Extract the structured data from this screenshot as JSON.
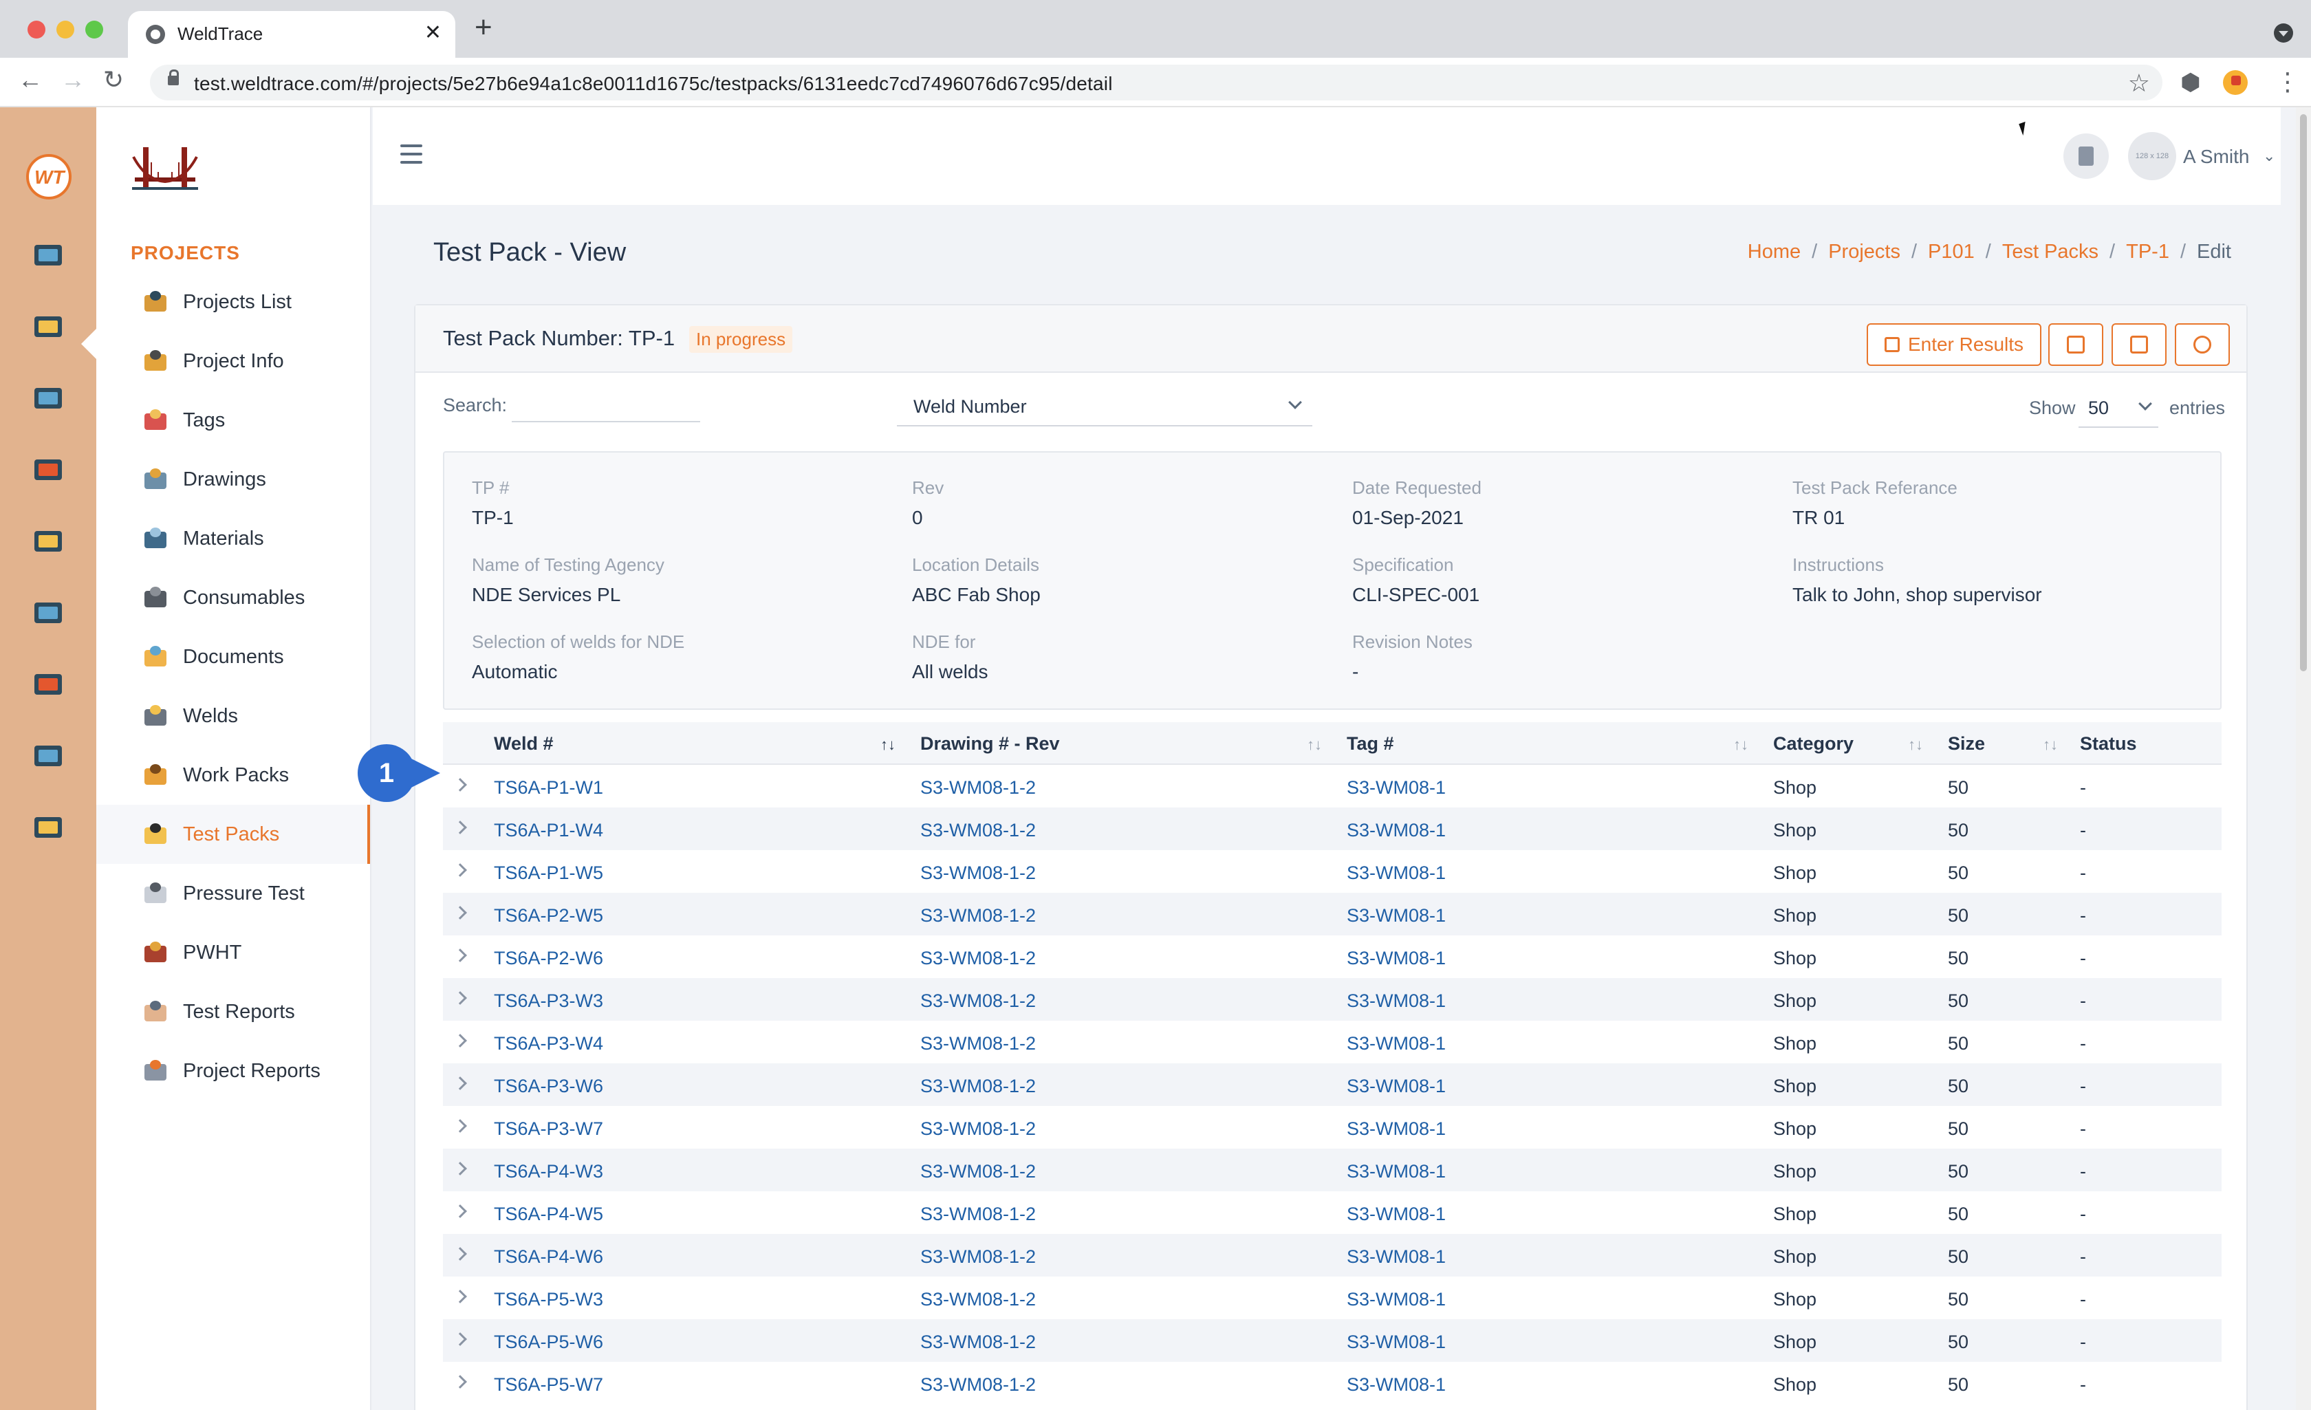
{
  "browser": {
    "tab_title": "WeldTrace",
    "tab_close": "✕",
    "new_tab": "+",
    "url": "test.weldtrace.com/#/projects/5e27b6e94a1c8e0011d1675c/testpacks/6131eedc7cd7496076d67c95/detail",
    "back": "←",
    "forward": "→",
    "reload": "↻",
    "star": "☆",
    "extensions": "⬢",
    "menu": "⋮"
  },
  "rail": {
    "logo_text": "WT",
    "icons": [
      "monitor-icon",
      "folder-gear-icon",
      "clipboard-gear-icon",
      "welder-icon",
      "org-chart-icon",
      "blueprint-icon",
      "team-icon",
      "report-icon",
      "badge-icon"
    ]
  },
  "sidebar": {
    "section_title": "PROJECTS",
    "items": [
      {
        "label": "Projects List",
        "icon": "camera-icon"
      },
      {
        "label": "Project Info",
        "icon": "gears-icon"
      },
      {
        "label": "Tags",
        "icon": "tag-icon"
      },
      {
        "label": "Drawings",
        "icon": "drawing-gear-icon"
      },
      {
        "label": "Materials",
        "icon": "pipes-icon"
      },
      {
        "label": "Consumables",
        "icon": "rods-icon"
      },
      {
        "label": "Documents",
        "icon": "folder-icon"
      },
      {
        "label": "Welds",
        "icon": "weld-spark-icon"
      },
      {
        "label": "Work Packs",
        "icon": "box-icon"
      },
      {
        "label": "Test Packs",
        "icon": "radiation-icon"
      },
      {
        "label": "Pressure Test",
        "icon": "gauge-icon"
      },
      {
        "label": "PWHT",
        "icon": "heater-icon"
      },
      {
        "label": "Test Reports",
        "icon": "checklist-icon"
      },
      {
        "label": "Project Reports",
        "icon": "chart-report-icon"
      }
    ],
    "active_label": "Test Packs"
  },
  "topbar": {
    "avatar_text": "128 x 128",
    "user_name": "A Smith",
    "user_caret": "⌄"
  },
  "page": {
    "title": "Test Pack - View",
    "breadcrumb": {
      "home": "Home",
      "projects": "Projects",
      "project": "P101",
      "test_packs": "Test Packs",
      "test_pack": "TP-1",
      "current": "Edit",
      "sep": "/"
    }
  },
  "card": {
    "title": "Test Pack Number: TP-1",
    "status": "In progress",
    "enter_results_label": "Enter Results"
  },
  "filters": {
    "search_label": "Search:",
    "search_value": "",
    "search_field": "Weld Number",
    "show_label": "Show",
    "page_size": "50",
    "entries_label": "entries"
  },
  "details": {
    "tp_number": {
      "label": "TP #",
      "value": "TP-1"
    },
    "rev": {
      "label": "Rev",
      "value": "0"
    },
    "date_requested": {
      "label": "Date Requested",
      "value": "01-Sep-2021"
    },
    "reference": {
      "label": "Test Pack Referance",
      "value": "TR 01"
    },
    "agency": {
      "label": "Name of Testing Agency",
      "value": "NDE Services PL"
    },
    "location": {
      "label": "Location Details",
      "value": "ABC Fab Shop"
    },
    "specification": {
      "label": "Specification",
      "value": "CLI-SPEC-001"
    },
    "instructions": {
      "label": "Instructions",
      "value": "Talk to John, shop supervisor"
    },
    "selection": {
      "label": "Selection of welds for NDE",
      "value": "Automatic"
    },
    "nde_for": {
      "label": "NDE for",
      "value": "All welds"
    },
    "revision_notes": {
      "label": "Revision Notes",
      "value": "-"
    }
  },
  "callout": {
    "number": "1",
    "color": "#2f6ccf"
  },
  "table": {
    "columns": {
      "weld": "Weld #",
      "drawing": "Drawing # - Rev",
      "tag": "Tag #",
      "category": "Category",
      "size": "Size",
      "status": "Status"
    },
    "sort_active": "↑↓",
    "sort_idle": "↑↓",
    "rows": [
      {
        "weld": "TS6A-P1-W1",
        "drawing": "S3-WM08-1-2",
        "tag": "S3-WM08-1",
        "category": "Shop",
        "size": "50",
        "status": "-"
      },
      {
        "weld": "TS6A-P1-W4",
        "drawing": "S3-WM08-1-2",
        "tag": "S3-WM08-1",
        "category": "Shop",
        "size": "50",
        "status": "-"
      },
      {
        "weld": "TS6A-P1-W5",
        "drawing": "S3-WM08-1-2",
        "tag": "S3-WM08-1",
        "category": "Shop",
        "size": "50",
        "status": "-"
      },
      {
        "weld": "TS6A-P2-W5",
        "drawing": "S3-WM08-1-2",
        "tag": "S3-WM08-1",
        "category": "Shop",
        "size": "50",
        "status": "-"
      },
      {
        "weld": "TS6A-P2-W6",
        "drawing": "S3-WM08-1-2",
        "tag": "S3-WM08-1",
        "category": "Shop",
        "size": "50",
        "status": "-"
      },
      {
        "weld": "TS6A-P3-W3",
        "drawing": "S3-WM08-1-2",
        "tag": "S3-WM08-1",
        "category": "Shop",
        "size": "50",
        "status": "-"
      },
      {
        "weld": "TS6A-P3-W4",
        "drawing": "S3-WM08-1-2",
        "tag": "S3-WM08-1",
        "category": "Shop",
        "size": "50",
        "status": "-"
      },
      {
        "weld": "TS6A-P3-W6",
        "drawing": "S3-WM08-1-2",
        "tag": "S3-WM08-1",
        "category": "Shop",
        "size": "50",
        "status": "-"
      },
      {
        "weld": "TS6A-P3-W7",
        "drawing": "S3-WM08-1-2",
        "tag": "S3-WM08-1",
        "category": "Shop",
        "size": "50",
        "status": "-"
      },
      {
        "weld": "TS6A-P4-W3",
        "drawing": "S3-WM08-1-2",
        "tag": "S3-WM08-1",
        "category": "Shop",
        "size": "50",
        "status": "-"
      },
      {
        "weld": "TS6A-P4-W5",
        "drawing": "S3-WM08-1-2",
        "tag": "S3-WM08-1",
        "category": "Shop",
        "size": "50",
        "status": "-"
      },
      {
        "weld": "TS6A-P4-W6",
        "drawing": "S3-WM08-1-2",
        "tag": "S3-WM08-1",
        "category": "Shop",
        "size": "50",
        "status": "-"
      },
      {
        "weld": "TS6A-P5-W3",
        "drawing": "S3-WM08-1-2",
        "tag": "S3-WM08-1",
        "category": "Shop",
        "size": "50",
        "status": "-"
      },
      {
        "weld": "TS6A-P5-W6",
        "drawing": "S3-WM08-1-2",
        "tag": "S3-WM08-1",
        "category": "Shop",
        "size": "50",
        "status": "-"
      },
      {
        "weld": "TS6A-P5-W7",
        "drawing": "S3-WM08-1-2",
        "tag": "S3-WM08-1",
        "category": "Shop",
        "size": "50",
        "status": "-"
      }
    ]
  },
  "colors": {
    "accent": "#e8762c",
    "link": "#1f5fa6",
    "rail": "#e2b38e"
  }
}
